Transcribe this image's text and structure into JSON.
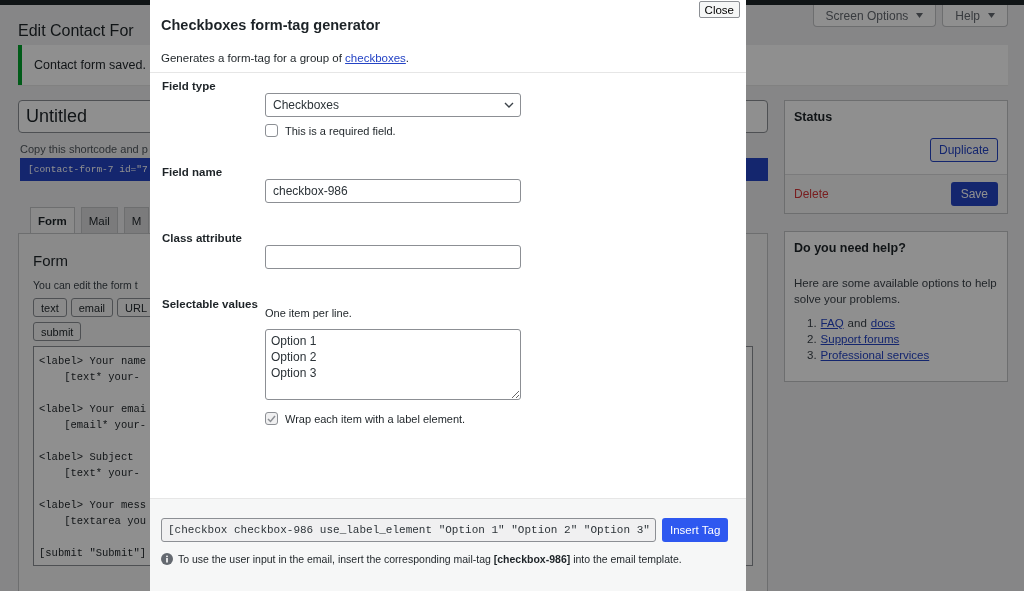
{
  "admin": {
    "page_title": "Edit Contact For",
    "screen_options": "Screen Options",
    "help": "Help",
    "notice": "Contact form saved.",
    "title_value": "Untitled",
    "shortcode_hint": "Copy this shortcode and p",
    "shortcode": "[contact-form-7 id=\"7",
    "tabs": [
      {
        "label": "Form",
        "selected": true
      },
      {
        "label": "Mail",
        "selected": false
      },
      {
        "label": "M",
        "selected": false
      }
    ],
    "panel": {
      "heading": "Form",
      "description": "You can edit the form t",
      "tag_buttons": [
        "text",
        "email",
        "URL",
        "submit"
      ],
      "code": "<label> Your name\n    [text* your-\n\n<label> Your emai\n    [email* your-\n\n<label> Subject\n    [text* your-\n\n<label> Your mess\n    [textarea you\n\n[submit \"Submit\"]"
    },
    "status": {
      "title": "Status",
      "duplicate": "Duplicate",
      "delete": "Delete",
      "save": "Save"
    },
    "help_box": {
      "title": "Do you need help?",
      "text": "Here are some available options to help solve your problems.",
      "items": [
        {
          "marker": "1.",
          "parts": [
            {
              "text": "FAQ",
              "kind": "link"
            },
            {
              "text": "and",
              "kind": "text"
            },
            {
              "text": "docs",
              "kind": "link"
            }
          ]
        },
        {
          "marker": "2.",
          "parts": [
            {
              "text": "Support forums",
              "kind": "link"
            }
          ]
        },
        {
          "marker": "3.",
          "parts": [
            {
              "text": "Professional services",
              "kind": "link"
            }
          ]
        }
      ]
    }
  },
  "dialog": {
    "title": "Checkboxes form-tag generator",
    "close": "Close",
    "intro": {
      "before": "Generates a form-tag for a group of ",
      "link": "checkboxes",
      "after": "."
    },
    "fields": [
      {
        "kind": "select",
        "label": "Field type",
        "value": "Checkboxes",
        "checkbox": {
          "label": "This is a required field.",
          "checked": false
        }
      },
      {
        "kind": "text",
        "label": "Field name",
        "value": "checkbox-986"
      },
      {
        "kind": "text",
        "label": "Class attribute"
      },
      {
        "kind": "textarea",
        "label": "Selectable values",
        "hint": "One item per line.",
        "value": "Option 1\nOption 2\nOption 3",
        "checkbox": {
          "label": "Wrap each item with a label element.",
          "checked": true
        }
      }
    ],
    "tag": "[checkbox checkbox-986 use_label_element \"Option 1\" \"Option 2\" \"Option 3\"",
    "insert": "Insert Tag",
    "note": "To use the user input in the email, insert the corresponding mail-tag **[checkbox-986]** into the email template."
  }
}
